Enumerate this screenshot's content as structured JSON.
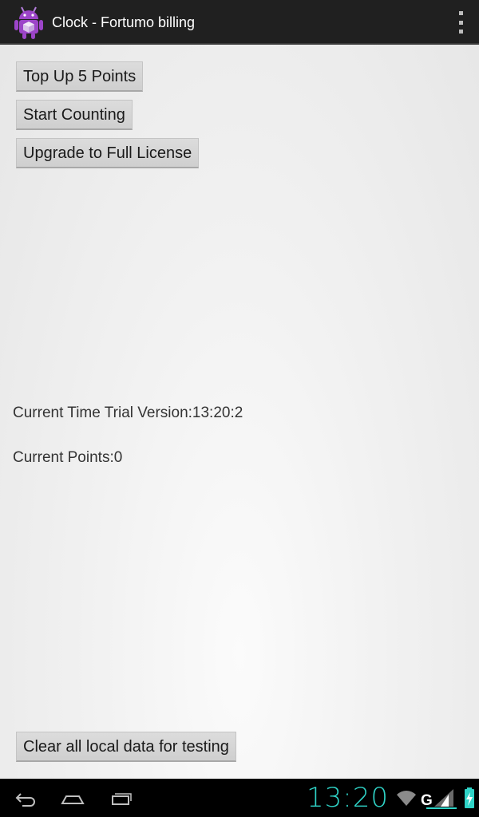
{
  "app": {
    "title": "Clock - Fortumo billing",
    "icon": "android-robot-icon",
    "accent_color": "#9c45c8"
  },
  "actions": {
    "top_up_label": "Top Up 5 Points",
    "start_counting_label": "Start Counting",
    "upgrade_label": "Upgrade to Full License",
    "clear_label": "Clear all local data for testing"
  },
  "status": {
    "time_text": "Current Time Trial Version:13:20:2",
    "points_text": "Current Points:0"
  },
  "system_bar": {
    "clock": "13:20",
    "clock_color": "#2fd3c7",
    "network_type": "G",
    "icons": [
      "back-icon",
      "home-icon",
      "recents-icon",
      "wifi-icon",
      "signal-icon",
      "battery-charging-icon"
    ]
  }
}
